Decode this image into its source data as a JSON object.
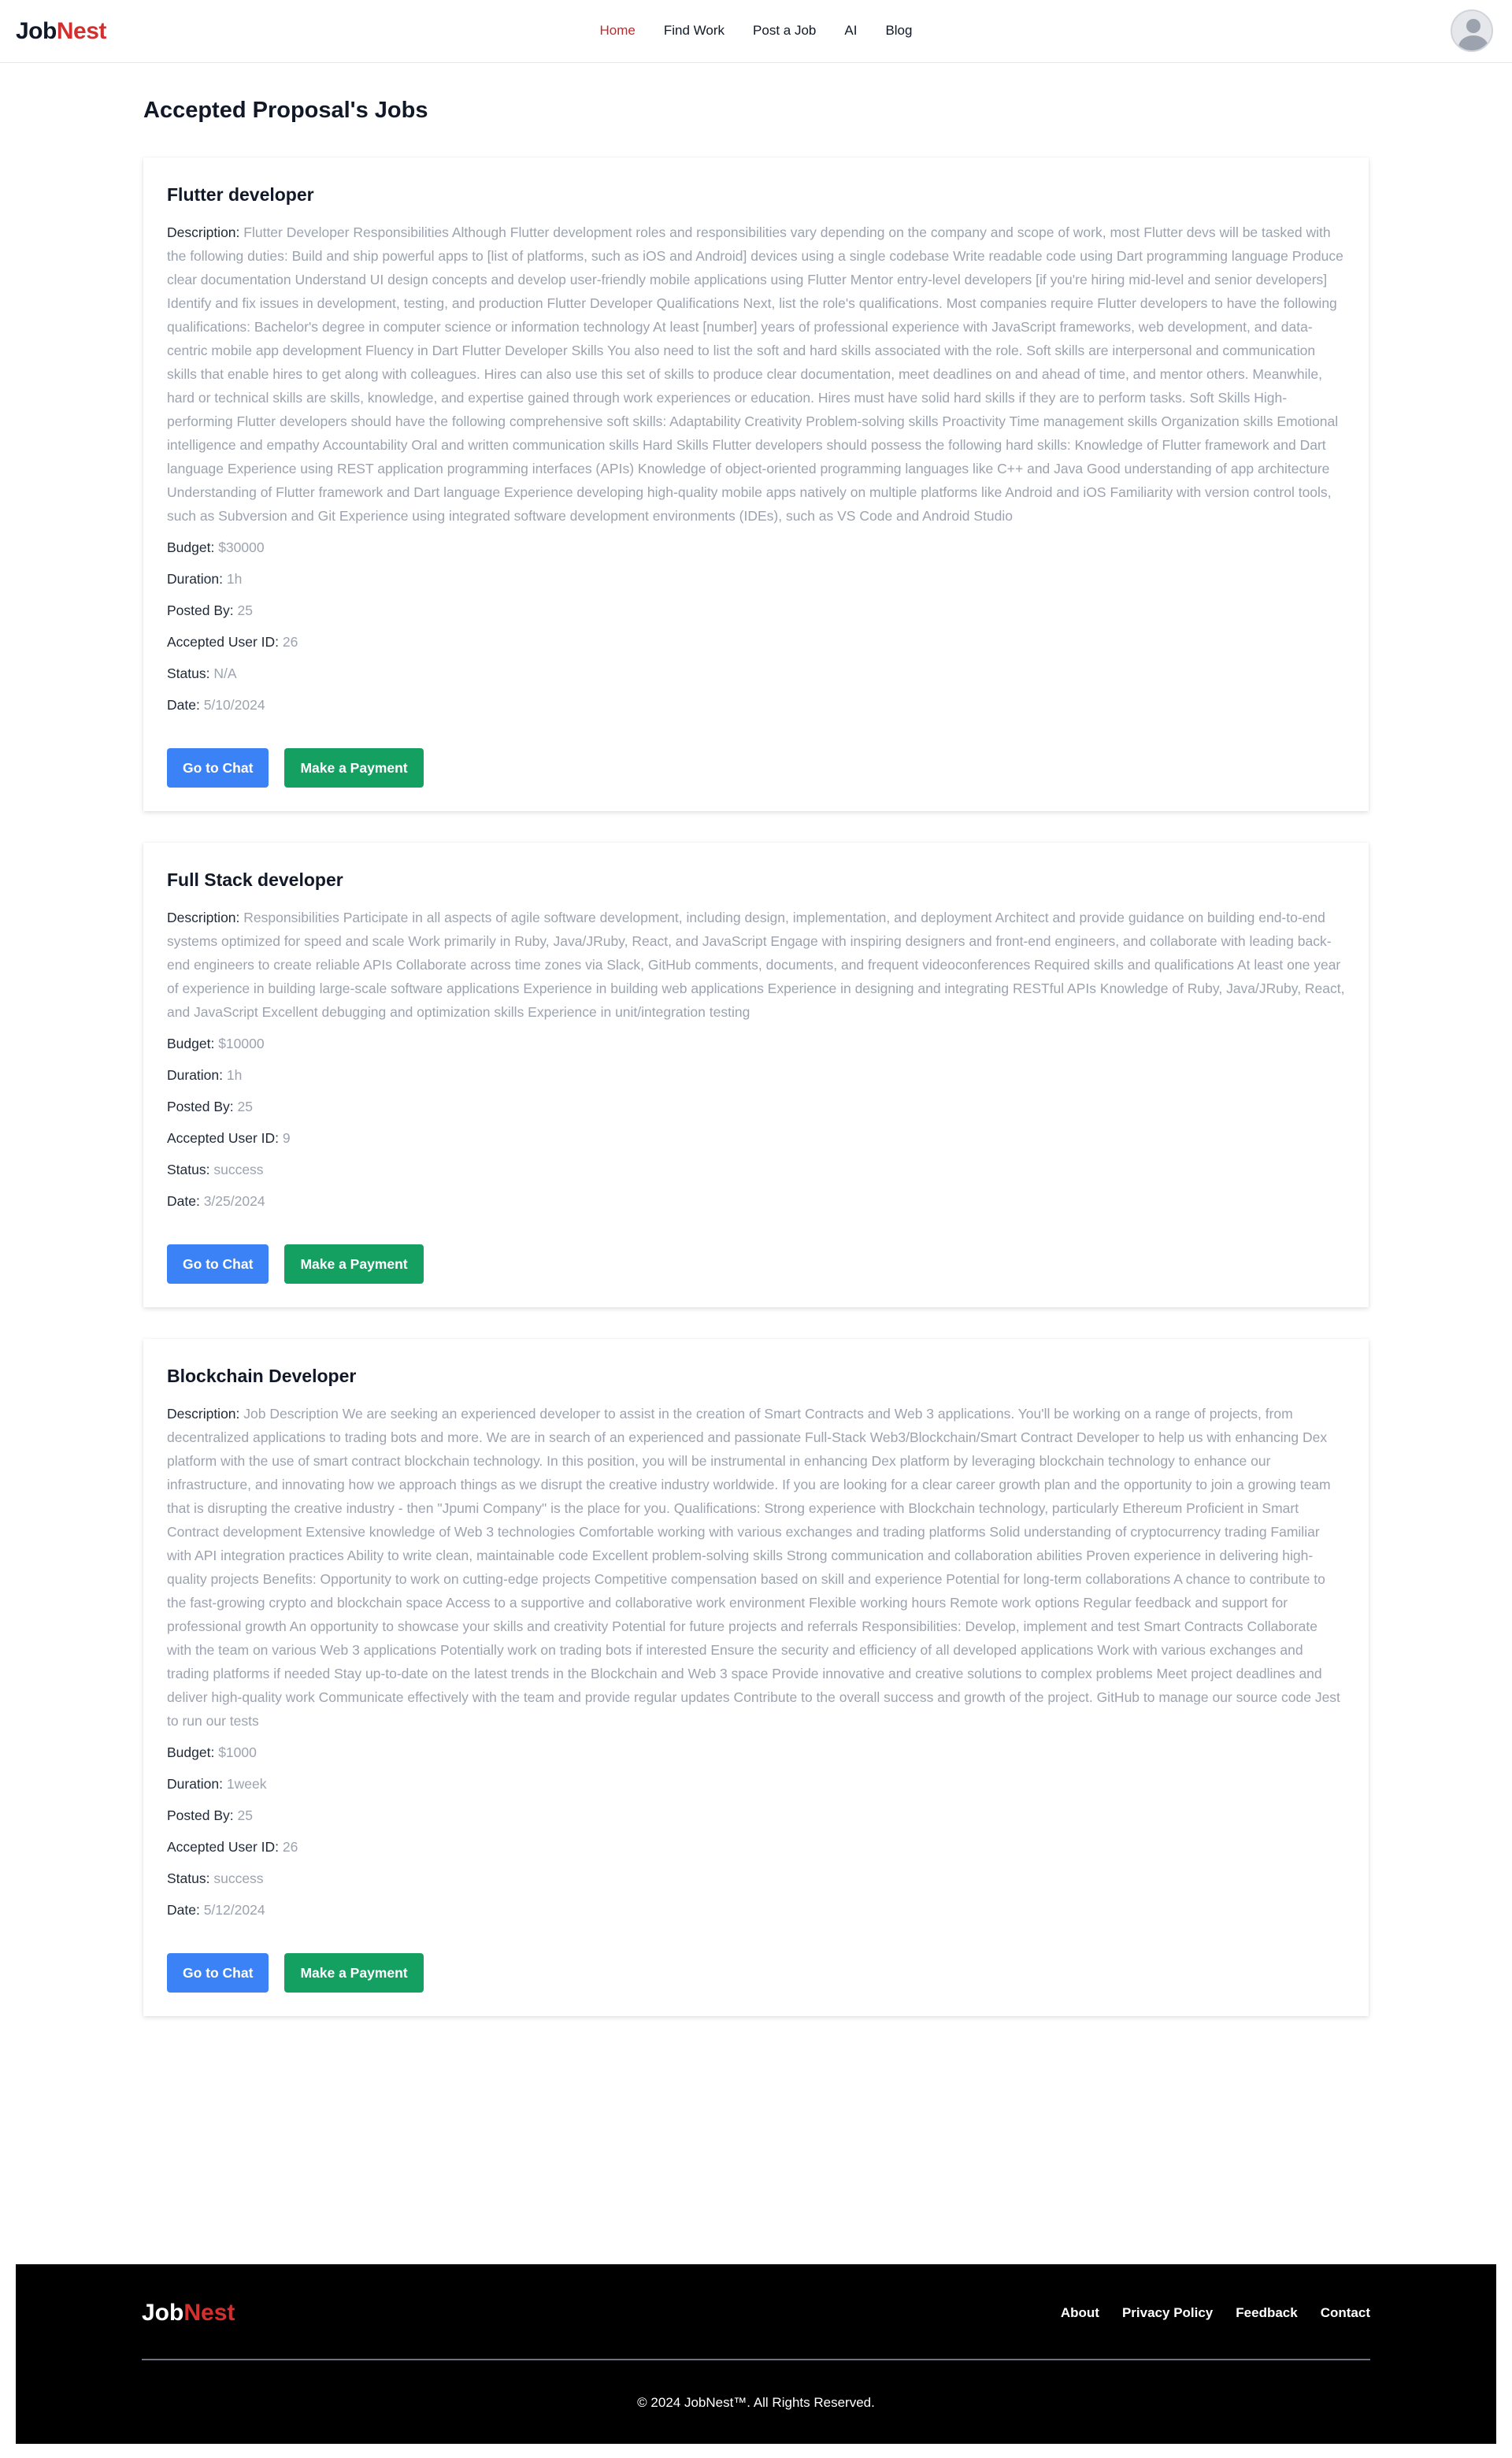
{
  "header": {
    "logo_part1": "Job",
    "logo_part2": "Nest",
    "nav": [
      "Home",
      "Find Work",
      "Post a Job",
      "AI",
      "Blog"
    ],
    "active_nav": "Home",
    "avatar_icon": "user-avatar-icon"
  },
  "page_title": "Accepted Proposal's Jobs",
  "labels": {
    "description": "Description: ",
    "budget": "Budget: ",
    "duration": "Duration: ",
    "posted_by": "Posted By: ",
    "accepted_user": "Accepted User ID: ",
    "status": "Status: ",
    "date": "Date: ",
    "chat_button": "Go to Chat",
    "payment_button": "Make a Payment"
  },
  "jobs": [
    {
      "title": "Flutter developer",
      "description": "Flutter Developer Responsibilities Although Flutter development roles and responsibilities vary depending on the company and scope of work, most Flutter devs will be tasked with the following duties: Build and ship powerful apps to [list of platforms, such as iOS and Android] devices using a single codebase Write readable code using Dart programming language Produce clear documentation Understand UI design concepts and develop user-friendly mobile applications using Flutter Mentor entry-level developers [if you're hiring mid-level and senior developers] Identify and fix issues in development, testing, and production Flutter Developer Qualifications Next, list the role's qualifications. Most companies require Flutter developers to have the following qualifications: Bachelor's degree in computer science or information technology At least [number] years of professional experience with JavaScript frameworks, web development, and data-centric mobile app development Fluency in Dart Flutter Developer Skills You also need to list the soft and hard skills associated with the role. Soft skills are interpersonal and communication skills that enable hires to get along with colleagues. Hires can also use this set of skills to produce clear documentation, meet deadlines on and ahead of time, and mentor others. Meanwhile, hard or technical skills are skills, knowledge, and expertise gained through work experiences or education. Hires must have solid hard skills if they are to perform tasks. Soft Skills High-performing Flutter developers should have the following comprehensive soft skills: Adaptability Creativity Problem-solving skills Proactivity Time management skills Organization skills Emotional intelligence and empathy Accountability Oral and written communication skills Hard Skills Flutter developers should possess the following hard skills: Knowledge of Flutter framework and Dart language Experience using REST application programming interfaces (APIs) Knowledge of object-oriented programming languages like C++ and Java Good understanding of app architecture Understanding of Flutter framework and Dart language Experience developing high-quality mobile apps natively on multiple platforms like Android and iOS Familiarity with version control tools, such as Subversion and Git Experience using integrated software development environments (IDEs), such as VS Code and Android Studio",
      "budget": "$30000",
      "duration": "1h",
      "posted_by": "25",
      "accepted_user_id": "26",
      "status": "N/A",
      "date": "5/10/2024"
    },
    {
      "title": "Full Stack developer",
      "description": "Responsibilities Participate in all aspects of agile software development, including design, implementation, and deployment Architect and provide guidance on building end-to-end systems optimized for speed and scale Work primarily in Ruby, Java/JRuby, React, and JavaScript Engage with inspiring designers and front-end engineers, and collaborate with leading back-end engineers to create reliable APIs Collaborate across time zones via Slack, GitHub comments, documents, and frequent videoconferences Required skills and qualifications At least one year of experience in building large-scale software applications Experience in building web applications Experience in designing and integrating RESTful APIs Knowledge of Ruby, Java/JRuby, React, and JavaScript Excellent debugging and optimization skills Experience in unit/integration testing",
      "budget": "$10000",
      "duration": "1h",
      "posted_by": "25",
      "accepted_user_id": "9",
      "status": "success",
      "date": "3/25/2024"
    },
    {
      "title": "Blockchain Developer",
      "description": "Job Description We are seeking an experienced developer to assist in the creation of Smart Contracts and Web 3 applications. You'll be working on a range of projects, from decentralized applications to trading bots and more. We are in search of an experienced and passionate Full-Stack Web3/Blockchain/Smart Contract Developer to help us with enhancing Dex platform with the use of smart contract blockchain technology. In this position, you will be instrumental in enhancing Dex platform by leveraging blockchain technology to enhance our infrastructure, and innovating how we approach things as we disrupt the creative industry worldwide. If you are looking for a clear career growth plan and the opportunity to join a growing team that is disrupting the creative industry - then \"Jpumi Company\" is the place for you. Qualifications: Strong experience with Blockchain technology, particularly Ethereum Proficient in Smart Contract development Extensive knowledge of Web 3 technologies Comfortable working with various exchanges and trading platforms Solid understanding of cryptocurrency trading Familiar with API integration practices Ability to write clean, maintainable code Excellent problem-solving skills Strong communication and collaboration abilities Proven experience in delivering high-quality projects Benefits: Opportunity to work on cutting-edge projects Competitive compensation based on skill and experience Potential for long-term collaborations A chance to contribute to the fast-growing crypto and blockchain space Access to a supportive and collaborative work environment Flexible working hours Remote work options Regular feedback and support for professional growth An opportunity to showcase your skills and creativity Potential for future projects and referrals Responsibilities: Develop, implement and test Smart Contracts Collaborate with the team on various Web 3 applications Potentially work on trading bots if interested Ensure the security and efficiency of all developed applications Work with various exchanges and trading platforms if needed Stay up-to-date on the latest trends in the Blockchain and Web 3 space Provide innovative and creative solutions to complex problems Meet project deadlines and deliver high-quality work Communicate effectively with the team and provide regular updates Contribute to the overall success and growth of the project. GitHub to manage our source code Jest to run our tests",
      "budget": "$1000",
      "duration": "1week",
      "posted_by": "25",
      "accepted_user_id": "26",
      "status": "success",
      "date": "5/12/2024"
    }
  ],
  "footer": {
    "logo_part1": "Job",
    "logo_part2": "Nest",
    "links": [
      "About",
      "Privacy Policy",
      "Feedback",
      "Contact"
    ],
    "copyright": "© 2024 JobNest™. All Rights Reserved."
  }
}
